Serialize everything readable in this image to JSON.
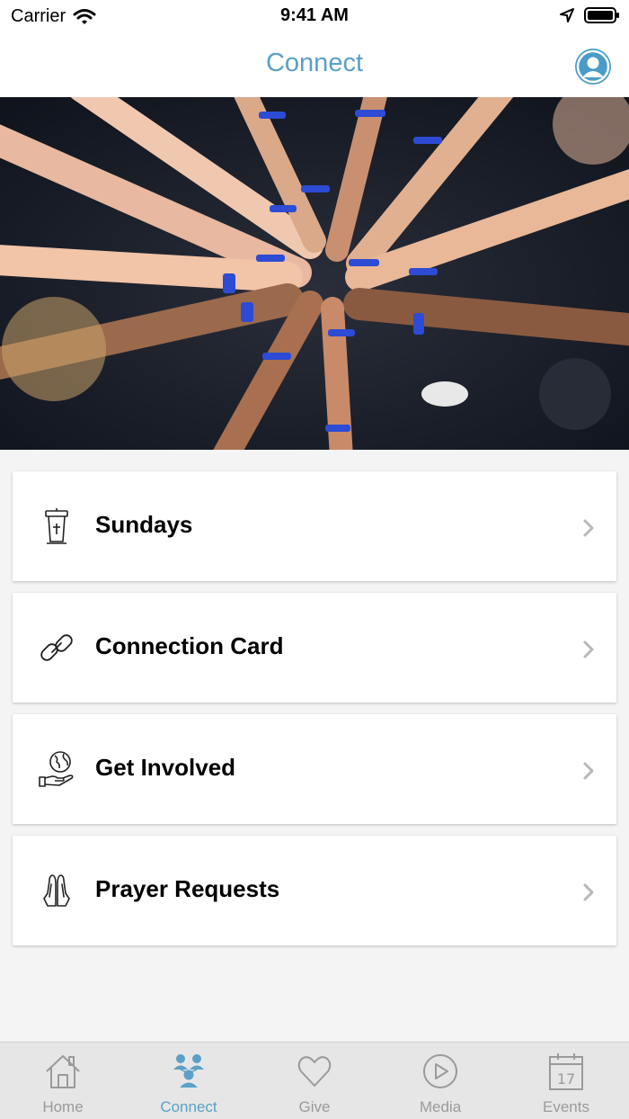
{
  "status_bar": {
    "carrier": "Carrier",
    "time": "9:41 AM"
  },
  "nav": {
    "title": "Connect"
  },
  "menu": {
    "items": [
      {
        "label": "Sundays",
        "icon": "pulpit-icon"
      },
      {
        "label": "Connection Card",
        "icon": "link-icon"
      },
      {
        "label": "Get Involved",
        "icon": "globe-hand-icon"
      },
      {
        "label": "Prayer Requests",
        "icon": "praying-hands-icon"
      }
    ]
  },
  "tabs": [
    {
      "label": "Home",
      "icon": "home-icon",
      "active": false
    },
    {
      "label": "Connect",
      "icon": "people-icon",
      "active": true
    },
    {
      "label": "Give",
      "icon": "heart-icon",
      "active": false
    },
    {
      "label": "Media",
      "icon": "play-icon",
      "active": false
    },
    {
      "label": "Events",
      "icon": "calendar-icon",
      "active": false,
      "date": "17"
    }
  ],
  "colors": {
    "accent": "#5aa0c8",
    "inactive": "#9a9a9a",
    "tabbar": "#e6e6e6",
    "background": "#f4f4f4"
  }
}
